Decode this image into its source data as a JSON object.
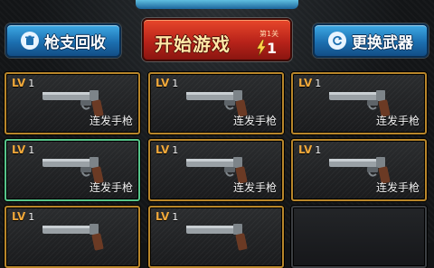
{
  "top": {
    "recycle_label": "枪支回收",
    "start_label": "开始游戏",
    "level_tag": "第1关",
    "level_value": "1",
    "change_label": "更换武器"
  },
  "cards": [
    {
      "lv_prefix": "LV",
      "lv": "1",
      "name": "连发手枪",
      "state": "normal"
    },
    {
      "lv_prefix": "LV",
      "lv": "1",
      "name": "连发手枪",
      "state": "normal"
    },
    {
      "lv_prefix": "LV",
      "lv": "1",
      "name": "连发手枪",
      "state": "normal"
    },
    {
      "lv_prefix": "LV",
      "lv": "1",
      "name": "连发手枪",
      "state": "selected"
    },
    {
      "lv_prefix": "LV",
      "lv": "1",
      "name": "连发手枪",
      "state": "normal"
    },
    {
      "lv_prefix": "LV",
      "lv": "1",
      "name": "连发手枪",
      "state": "normal"
    },
    {
      "lv_prefix": "LV",
      "lv": "1",
      "name": "",
      "state": "normal"
    },
    {
      "lv_prefix": "LV",
      "lv": "1",
      "name": "",
      "state": "normal"
    },
    {
      "lv_prefix": "",
      "lv": "",
      "name": "",
      "state": "empty"
    }
  ],
  "colors": {
    "gold_border": "#b8862a",
    "selected_border": "#56c48a",
    "lv_text": "#f0a83a",
    "start_red": "#b8231a",
    "button_blue": "#1c6fb0"
  }
}
